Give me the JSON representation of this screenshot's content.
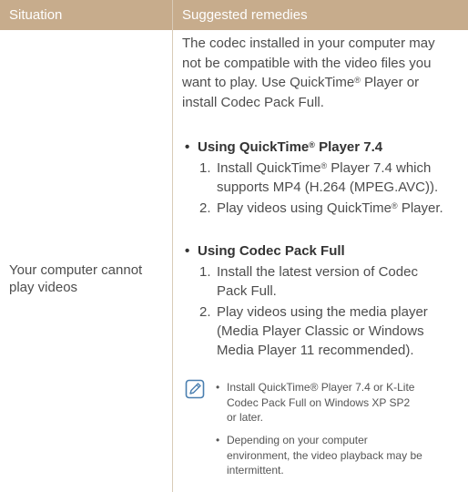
{
  "table": {
    "headers": [
      "Situation",
      "Suggested remedies"
    ],
    "situation": [
      "Your computer cannot",
      "play videos"
    ]
  },
  "remedies": {
    "intro": [
      "The codec installed in your computer may",
      "not be compatible with the video files you",
      "want to play. Use QuickTime",
      " Player or",
      "install Codec Pack Full."
    ],
    "registered_mark": "®",
    "quicktime": {
      "heading_pre": "Using QuickTime",
      "heading_post": " Player 7.4",
      "step1_num": "1.",
      "step1_a": "Install QuickTime",
      "step1_b": " Player 7.4 which",
      "step1_c": "supports MP4 (H.264 (MPEG.AVC)).",
      "step2_num": "2.",
      "step2_a": "Play videos using QuickTime",
      "step2_b": " Player."
    },
    "codec": {
      "heading": "Using Codec Pack Full",
      "step1_num": "1.",
      "step1": [
        "Install the latest version of Codec",
        "Pack Full."
      ],
      "step2_num": "2.",
      "step2": [
        "Play videos using the media player",
        "(Media Player Classic or Windows",
        "Media Player 11 recommended)."
      ]
    }
  },
  "notes": [
    [
      "Install QuickTime® Player 7.4 or K-Lite",
      "Codec Pack Full on Windows XP SP2",
      "or later."
    ],
    [
      "Depending on your computer",
      "environment, the video playback may be",
      "intermittent."
    ]
  ],
  "colors": {
    "header_bg": "#c7ac8c",
    "header_text": "#ffffff",
    "body_text": "#4d4d4d",
    "divider": "#d9cbb8"
  }
}
